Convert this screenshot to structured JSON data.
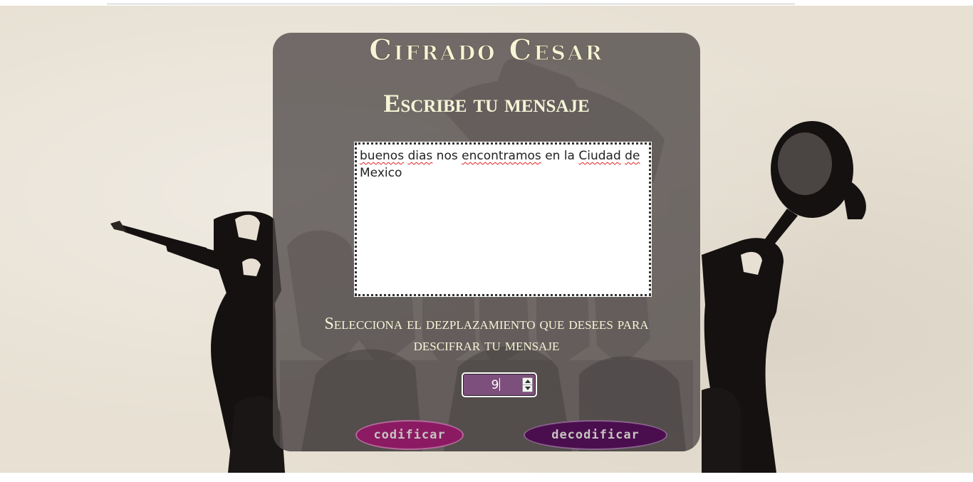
{
  "app": {
    "title": "Cifrado Cesar",
    "subtitle": "Escribe tu mensaje"
  },
  "message": {
    "words": [
      {
        "text": "buenos",
        "misspelled": true
      },
      {
        "text": "dias",
        "misspelled": true
      },
      {
        "text": "nos",
        "misspelled": false
      },
      {
        "text": "encontramos",
        "misspelled": true
      },
      {
        "text": "en",
        "misspelled": false
      },
      {
        "text": "la",
        "misspelled": false
      },
      {
        "text": "Ciudad",
        "misspelled": true
      },
      {
        "text": "de",
        "misspelled": true
      },
      {
        "text": "Mexico",
        "misspelled": false
      }
    ]
  },
  "shift": {
    "label": "Selecciona el dezplazamiento que desees para descifrar tu mensaje",
    "value": "9"
  },
  "buttons": {
    "encode_label": "codificar",
    "decode_label": "decodificar"
  },
  "colors": {
    "panel": "#4e4848",
    "title_text": "#f4f5d6",
    "encode_button": "#8b1a63",
    "decode_button": "#4a0e4e",
    "shift_input": "#7d4f7c",
    "spellcheck_underline": "#e02020"
  },
  "icons": {
    "background_left": "fountain-pen-fist-icon",
    "background_right": "microphone-fist-icon",
    "background_center": "raised-fists-icon",
    "spinner_up": "spinner-up-icon",
    "spinner_down": "spinner-down-icon"
  }
}
